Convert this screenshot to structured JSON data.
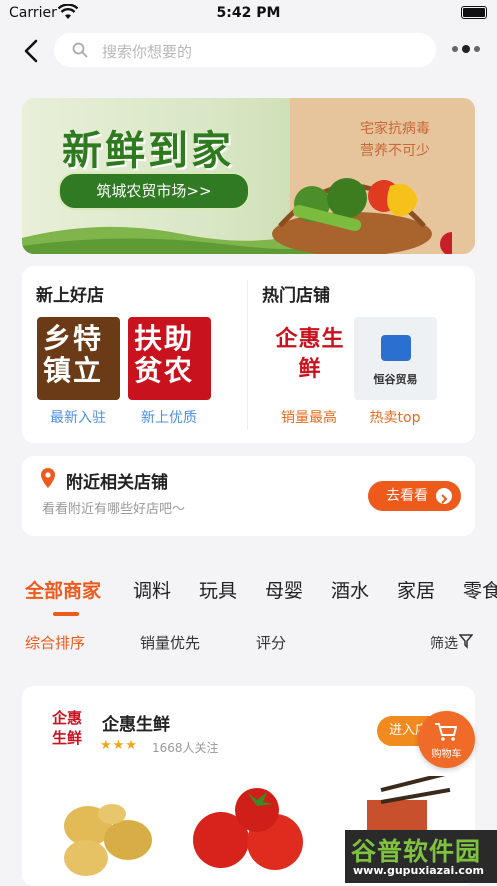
{
  "status_bar": {
    "carrier": "Carrier",
    "time": "5:42 PM"
  },
  "search": {
    "placeholder": "搜索你想要的"
  },
  "banner": {
    "title": "新鲜到家",
    "button": "筑城农贸市场>>",
    "slogan_1": "宅家抗病毒",
    "slogan_2": "营养不可少"
  },
  "new_shops": {
    "title": "新上好店",
    "items": [
      {
        "logo_text": "乡特镇立",
        "caption": "最新入驻"
      },
      {
        "logo_text": "扶助贫农",
        "caption": "新上优质"
      }
    ]
  },
  "hot_shops": {
    "title": "热门店铺",
    "items": [
      {
        "logo_text": "企惠生鲜",
        "caption": "销量最高"
      },
      {
        "logo_text": "恒谷贸易",
        "caption": "热卖top"
      }
    ]
  },
  "nearby": {
    "title": "附近相关店铺",
    "subtitle": "看看附近有哪些好店吧～",
    "button": "去看看"
  },
  "categories": [
    "全部商家",
    "调料",
    "玩具",
    "母婴",
    "酒水",
    "家居",
    "零食"
  ],
  "sort_options": {
    "comprehensive": "综合排序",
    "sales": "销量优先",
    "rating": "评分",
    "filter": "筛选"
  },
  "merchant": {
    "name": "企惠生鲜",
    "stars": "★★★",
    "followers": "1668人关注",
    "enter": "进入店铺"
  },
  "cart": {
    "label": "购物车"
  },
  "watermark": {
    "name": "谷普软件园",
    "url": "www.gupuxiazai.com"
  },
  "colors": {
    "accent": "#ee5a1c",
    "caption_blue": "#4d8fe0"
  }
}
